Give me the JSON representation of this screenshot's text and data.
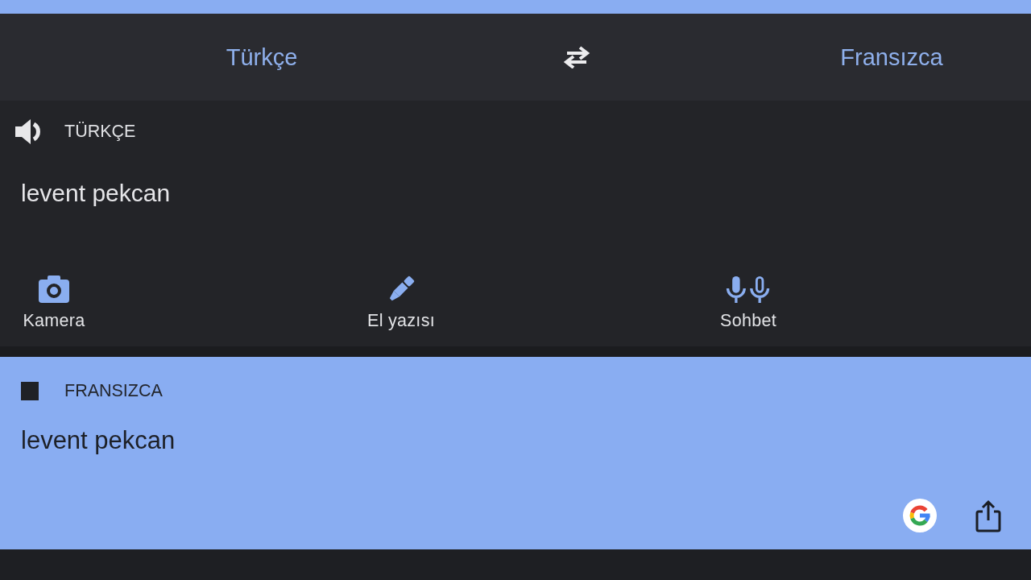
{
  "language_bar": {
    "source": "Türkçe",
    "target": "Fransızca"
  },
  "source_panel": {
    "language": "TÜRKÇE",
    "text": "levent pekcan",
    "tools": [
      {
        "kind": "camera",
        "label": "Kamera"
      },
      {
        "kind": "handwriting",
        "label": "El yazısı"
      },
      {
        "kind": "conversation",
        "label": "Sohbet"
      }
    ]
  },
  "result_panel": {
    "language": "FRANSIZCA",
    "text": "levent pekcan",
    "speaking": true
  }
}
